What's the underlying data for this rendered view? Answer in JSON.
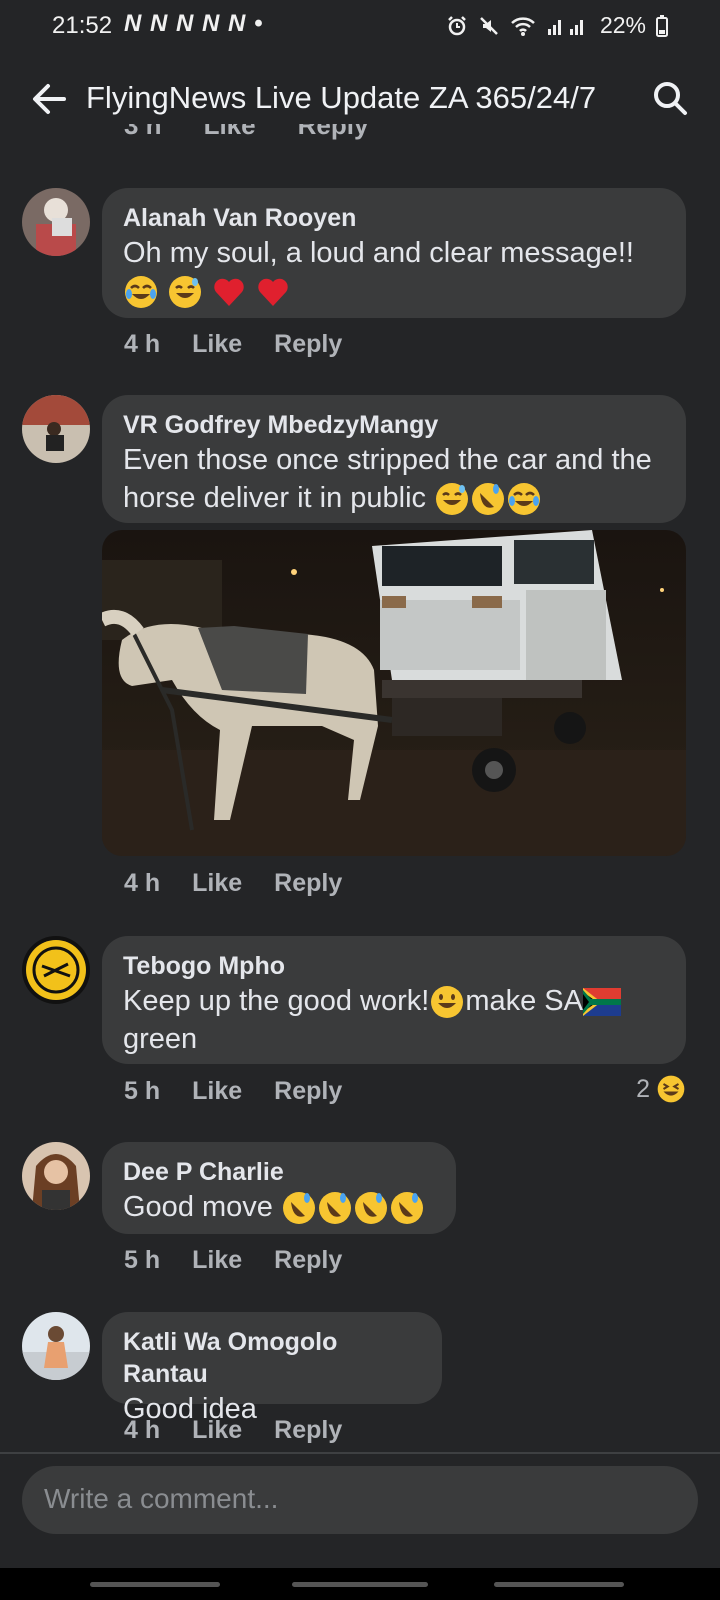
{
  "status": {
    "time": "21:52",
    "notifications": "N N N N N •",
    "battery": "22%"
  },
  "header": {
    "title": "FlyingNews Live Update ZA 365/24/7"
  },
  "top_cut": {
    "time": "3 h",
    "like": "Like",
    "reply": "Reply"
  },
  "comments": [
    {
      "author": "Alanah Van Rooyen",
      "text": "Oh my soul, a loud and clear message!!",
      "time": "4 h",
      "like": "Like",
      "reply": "Reply"
    },
    {
      "author": "VR Godfrey MbedzyMangy",
      "text_line1": "Even those once stripped the car and the",
      "text_line2": "horse deliver it in public",
      "time": "4 h",
      "like": "Like",
      "reply": "Reply"
    },
    {
      "author": "Tebogo Mpho",
      "text_line1a": "Keep up the good work!",
      "text_line1b": "make SA",
      "text_line2": "green",
      "time": "5 h",
      "like": "Like",
      "reply": "Reply",
      "reaction_count": "2"
    },
    {
      "author": "Dee P Charlie",
      "text": "Good move",
      "time": "5 h",
      "like": "Like",
      "reply": "Reply"
    },
    {
      "author": "Katli Wa Omogolo Rantau",
      "text": "Good idea",
      "time": "4 h",
      "like": "Like",
      "reply": "Reply"
    }
  ],
  "composer": {
    "placeholder": "Write a comment..."
  },
  "icons": [
    "back-arrow-icon",
    "search-icon",
    "alarm-icon",
    "mute-icon",
    "wifi-icon",
    "signal-icon",
    "battery-icon"
  ],
  "colors": {
    "background": "#242527",
    "bubble": "#3a3b3c",
    "text": "#e4e6eb",
    "muted": "#b0b3b8"
  }
}
